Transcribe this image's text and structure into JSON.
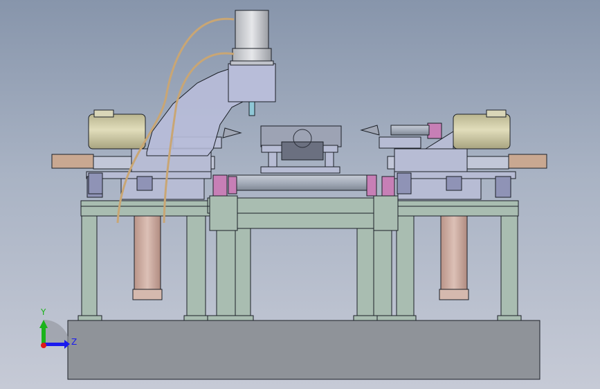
{
  "viewport": {
    "background_top": "#8795ab",
    "background_bottom": "#c6cad6"
  },
  "triad": {
    "y_label": "Y",
    "z_label": "Z",
    "y_color": "#1bb31b",
    "z_color": "#1a1aee",
    "x_color": "#e01818"
  },
  "colors": {
    "frame": "#a9bdb1",
    "base": "#8f9399",
    "cylinder": "#caa99d",
    "motor": "#cbc7a2",
    "arm": "#b8bdd9",
    "accent_pink": "#c77fb6",
    "hose": "#c9a674"
  }
}
